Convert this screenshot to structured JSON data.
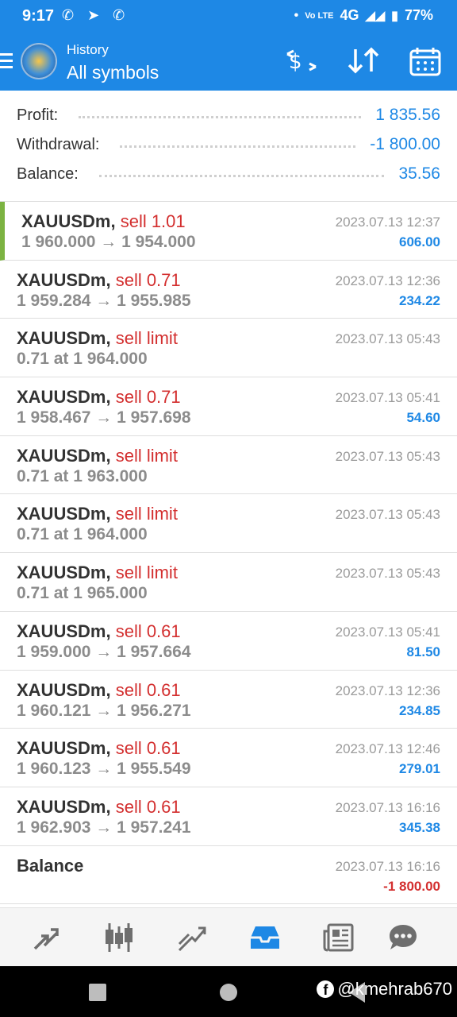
{
  "status_bar": {
    "time": "9:17",
    "left_icons": "✆ ➤ ✆",
    "network": "4G",
    "battery": "77%"
  },
  "appbar": {
    "subtitle": "History",
    "title": "All symbols",
    "icons": [
      "exchange-dollar-icon",
      "sort-icon",
      "calendar-icon"
    ]
  },
  "summary": {
    "profit_label": "Profit:",
    "profit_value": "1 835.56",
    "withdrawal_label": "Withdrawal:",
    "withdrawal_value": "-1 800.00",
    "balance_label": "Balance:",
    "balance_value": "35.56"
  },
  "trades": [
    {
      "symbol": "XAUUSDm,",
      "type": "sell 1.01",
      "price": "1 960.000 → 1 954.000",
      "date": "2023.07.13 12:37",
      "profit": "606.00"
    },
    {
      "symbol": "XAUUSDm,",
      "type": "sell 0.71",
      "price": "1 959.284 → 1 955.985",
      "date": "2023.07.13 12:36",
      "profit": "234.22"
    },
    {
      "symbol": "XAUUSDm,",
      "type": "sell limit",
      "price": "0.71 at 1 964.000",
      "date": "2023.07.13 05:43",
      "profit": ""
    },
    {
      "symbol": "XAUUSDm,",
      "type": "sell 0.71",
      "price": "1 958.467 → 1 957.698",
      "date": "2023.07.13 05:41",
      "profit": "54.60"
    },
    {
      "symbol": "XAUUSDm,",
      "type": "sell limit",
      "price": "0.71 at 1 963.000",
      "date": "2023.07.13 05:43",
      "profit": ""
    },
    {
      "symbol": "XAUUSDm,",
      "type": "sell limit",
      "price": "0.71 at 1 964.000",
      "date": "2023.07.13 05:43",
      "profit": ""
    },
    {
      "symbol": "XAUUSDm,",
      "type": "sell limit",
      "price": "0.71 at 1 965.000",
      "date": "2023.07.13 05:43",
      "profit": ""
    },
    {
      "symbol": "XAUUSDm,",
      "type": "sell 0.61",
      "price": "1 959.000 → 1 957.664",
      "date": "2023.07.13 05:41",
      "profit": "81.50"
    },
    {
      "symbol": "XAUUSDm,",
      "type": "sell 0.61",
      "price": "1 960.121 → 1 956.271",
      "date": "2023.07.13 12:36",
      "profit": "234.85"
    },
    {
      "symbol": "XAUUSDm,",
      "type": "sell 0.61",
      "price": "1 960.123 → 1 955.549",
      "date": "2023.07.13 12:46",
      "profit": "279.01"
    },
    {
      "symbol": "XAUUSDm,",
      "type": "sell 0.61",
      "price": "1 962.903 → 1 957.241",
      "date": "2023.07.13 16:16",
      "profit": "345.38"
    }
  ],
  "balance_entry": {
    "label": "Balance",
    "date": "2023.07.13 16:16",
    "amount": "-1 800.00"
  },
  "bottom_nav": [
    {
      "name": "quotes-icon",
      "active": false
    },
    {
      "name": "chart-icon",
      "active": false
    },
    {
      "name": "trade-icon",
      "active": false
    },
    {
      "name": "history-icon",
      "active": true
    },
    {
      "name": "news-icon",
      "active": false
    },
    {
      "name": "chat-icon",
      "active": false
    }
  ],
  "watermark": "@kmehrab670",
  "colors": {
    "accent": "#1e88e5",
    "sell": "#d32f2f",
    "highlight": "#7cb342"
  }
}
